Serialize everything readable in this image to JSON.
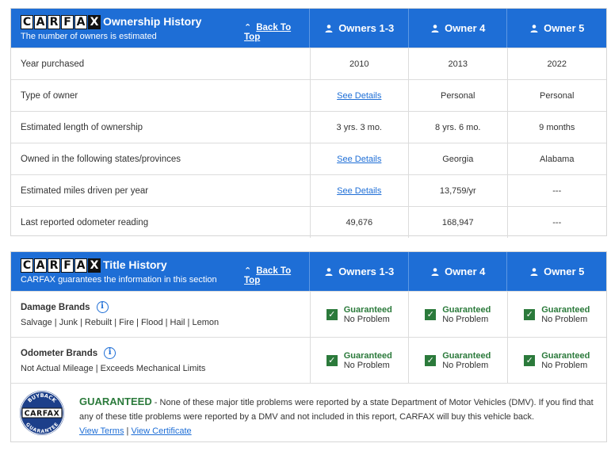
{
  "brand": {
    "letters": [
      "C",
      "A",
      "R",
      "F",
      "A",
      "X"
    ]
  },
  "ownership": {
    "title": "Ownership History",
    "subtitle": "The number of owners is estimated",
    "back_to_top": "Back To Top",
    "columns": [
      "Owners 1-3",
      "Owner 4",
      "Owner 5"
    ],
    "rows": [
      {
        "label": "Year purchased",
        "values": [
          "2010",
          "2013",
          "2022"
        ]
      },
      {
        "label": "Type of owner",
        "values": [
          "See Details",
          "Personal",
          "Personal"
        ]
      },
      {
        "label": "Estimated length of ownership",
        "values": [
          "3 yrs. 3 mo.",
          "8 yrs. 6 mo.",
          "9 months"
        ]
      },
      {
        "label": "Owned in the following states/provinces",
        "values": [
          "See Details",
          "Georgia",
          "Alabama"
        ]
      },
      {
        "label": "Estimated miles driven per year",
        "values": [
          "See Details",
          "13,759/yr",
          "---"
        ]
      },
      {
        "label": "Last reported odometer reading",
        "values": [
          "49,676",
          "168,947",
          "---"
        ]
      }
    ]
  },
  "title_history": {
    "title": "Title History",
    "subtitle": "CARFAX guarantees the information in this section",
    "back_to_top": "Back To Top",
    "columns": [
      "Owners 1-3",
      "Owner 4",
      "Owner 5"
    ],
    "rows": [
      {
        "label": "Damage Brands",
        "details": "Salvage | Junk | Rebuilt | Fire | Flood | Hail | Lemon",
        "status": [
          {
            "line1": "Guaranteed",
            "line2": "No Problem"
          },
          {
            "line1": "Guaranteed",
            "line2": "No Problem"
          },
          {
            "line1": "Guaranteed",
            "line2": "No Problem"
          }
        ]
      },
      {
        "label": "Odometer Brands",
        "details": "Not Actual Mileage | Exceeds Mechanical Limits",
        "status": [
          {
            "line1": "Guaranteed",
            "line2": "No Problem"
          },
          {
            "line1": "Guaranteed",
            "line2": "No Problem"
          },
          {
            "line1": "Guaranteed",
            "line2": "No Problem"
          }
        ]
      }
    ],
    "guarantee": {
      "heading": "GUARANTEED",
      "body": " - None of these major title problems were reported by a state Department of Motor Vehicles (DMV). If you find that any of these title problems were reported by a DMV and not included in this report, CARFAX will buy this vehicle back.",
      "view_terms": "View Terms",
      "separator": " | ",
      "view_certificate": "View Certificate",
      "seal_top": "BUYBACK",
      "seal_bottom": "GUARANTEE",
      "seal_brand": "CARFAX"
    }
  },
  "colors": {
    "header_blue": "#1e6ed6",
    "guaranteed_green": "#2b7a3b"
  }
}
